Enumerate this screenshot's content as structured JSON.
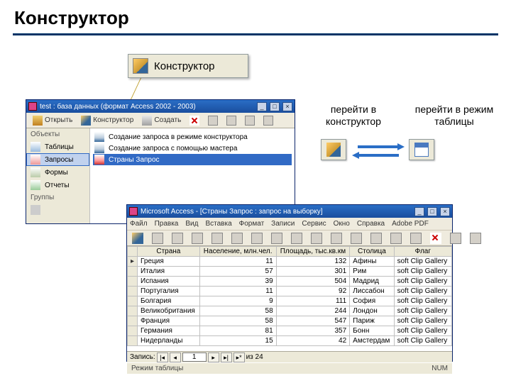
{
  "slide": {
    "title": "Конструктор"
  },
  "konstruktor_button": {
    "label": "Конструктор"
  },
  "annotations": {
    "go_design": "перейти в конструктор",
    "go_table": "перейти в режим таблицы"
  },
  "db_window": {
    "title": "test : база данных (формат Access 2002 - 2003)",
    "toolbar": {
      "open": "Открыть",
      "design": "Конструктор",
      "create": "Создать"
    },
    "sidebar": {
      "header": "Объекты",
      "items": [
        "Таблицы",
        "Запросы",
        "Формы",
        "Отчеты"
      ],
      "groups": "Группы"
    },
    "list": [
      "Создание запроса в режиме конструктора",
      "Создание запроса с помощью мастера",
      "Страны Запрос"
    ]
  },
  "sheet_window": {
    "title": "Microsoft Access - [Страны Запрос : запрос на выборку]",
    "menu": [
      "Файл",
      "Правка",
      "Вид",
      "Вставка",
      "Формат",
      "Записи",
      "Сервис",
      "Окно",
      "Справка",
      "Adobe PDF"
    ],
    "columns": [
      "Страна",
      "Население, млн.чел.",
      "Площадь, тыс.кв.км",
      "Столица",
      "Флаг"
    ],
    "rows": [
      {
        "country": "Греция",
        "pop": 11,
        "area": 132,
        "capital": "Афины",
        "flag": "soft Clip Gallery"
      },
      {
        "country": "Италия",
        "pop": 57,
        "area": 301,
        "capital": "Рим",
        "flag": "soft Clip Gallery"
      },
      {
        "country": "Испания",
        "pop": 39,
        "area": 504,
        "capital": "Мадрид",
        "flag": "soft Clip Gallery"
      },
      {
        "country": "Португалия",
        "pop": 11,
        "area": 92,
        "capital": "Лиссабон",
        "flag": "soft Clip Gallery"
      },
      {
        "country": "Болгария",
        "pop": 9,
        "area": 111,
        "capital": "София",
        "flag": "soft Clip Gallery"
      },
      {
        "country": "Великобритания",
        "pop": 58,
        "area": 244,
        "capital": "Лондон",
        "flag": "soft Clip Gallery"
      },
      {
        "country": "Франция",
        "pop": 58,
        "area": 547,
        "capital": "Париж",
        "flag": "soft Clip Gallery"
      },
      {
        "country": "Германия",
        "pop": 81,
        "area": 357,
        "capital": "Бонн",
        "flag": "soft Clip Gallery"
      },
      {
        "country": "Нидерланды",
        "pop": 15,
        "area": 42,
        "capital": "Амстердам",
        "flag": "soft Clip Gallery"
      }
    ],
    "nav": {
      "label": "Запись:",
      "current": "1",
      "total": "из 24"
    },
    "status_left": "Режим таблицы",
    "status_right": "NUM"
  }
}
